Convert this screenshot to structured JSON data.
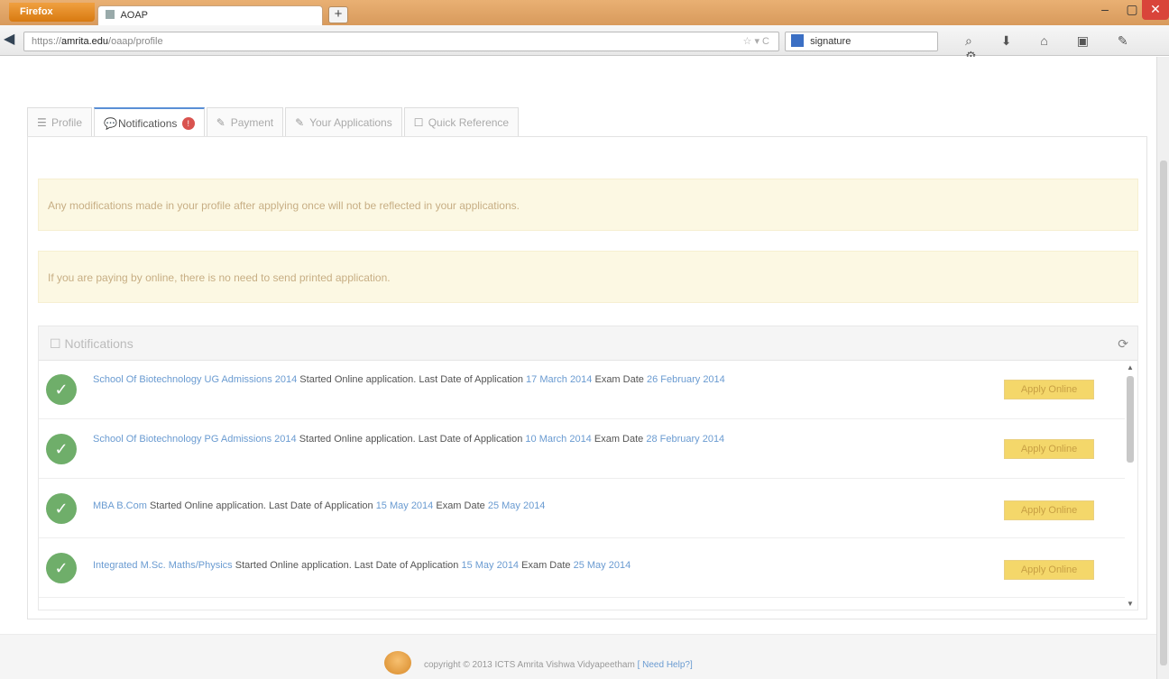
{
  "browser": {
    "app_button": "Firefox",
    "tab_title": "AOAP",
    "new_tab": "+",
    "window_controls": {
      "minimize": "–",
      "maximize": "▢",
      "close": "✕"
    },
    "back": "◀",
    "url_prefix": "https://",
    "url_domain": "amrita.edu",
    "url_path": "/oaap/profile",
    "url_tools": "☆ ▾ C",
    "search_text": "signature",
    "toolbar_icons": [
      "⌕",
      "⬇",
      "⌂",
      "▣",
      "✎",
      "⚙"
    ]
  },
  "tabs": [
    {
      "icon": "☰",
      "label": "Profile"
    },
    {
      "icon": "💬",
      "label": "Notifications",
      "badge": "!"
    },
    {
      "icon": "✎",
      "label": "Payment"
    },
    {
      "icon": "✎",
      "label": "Your Applications"
    },
    {
      "icon": "☐",
      "label": "Quick Reference"
    }
  ],
  "alerts": [
    "Any modifications made in your profile after applying once will not be reflected in your applications.",
    "If you are paying by online, there is no need to send printed application."
  ],
  "notifications": {
    "title": "Notifications",
    "refresh_icon": "⟳",
    "apply_label": "Apply Online",
    "items": [
      {
        "link": "School Of Biotechnology UG Admissions 2014",
        "text": " Started Online application. Last Date of Application ",
        "date1": "17 March 2014",
        "mid": " Exam Date ",
        "date2": "26 February 2014"
      },
      {
        "link": "School Of Biotechnology PG Admissions 2014",
        "text": " Started Online application. Last Date of Application ",
        "date1": "10 March 2014",
        "mid": " Exam Date ",
        "date2": "28 February 2014"
      },
      {
        "link": "MBA B.Com",
        "text": " Started Online application. Last Date of Application ",
        "date1": "15 May 2014",
        "mid": " Exam Date ",
        "date2": "25 May 2014"
      },
      {
        "link": "Integrated M.Sc. Maths/Physics",
        "text": " Started Online application. Last Date of Application ",
        "date1": "15 May 2014",
        "mid": " Exam Date ",
        "date2": "25 May 2014"
      }
    ]
  },
  "footer": {
    "copyright": "copyright © 2013 ICTS Amrita Vishwa Vidyapeetham",
    "link": "[ Need Help?]"
  }
}
